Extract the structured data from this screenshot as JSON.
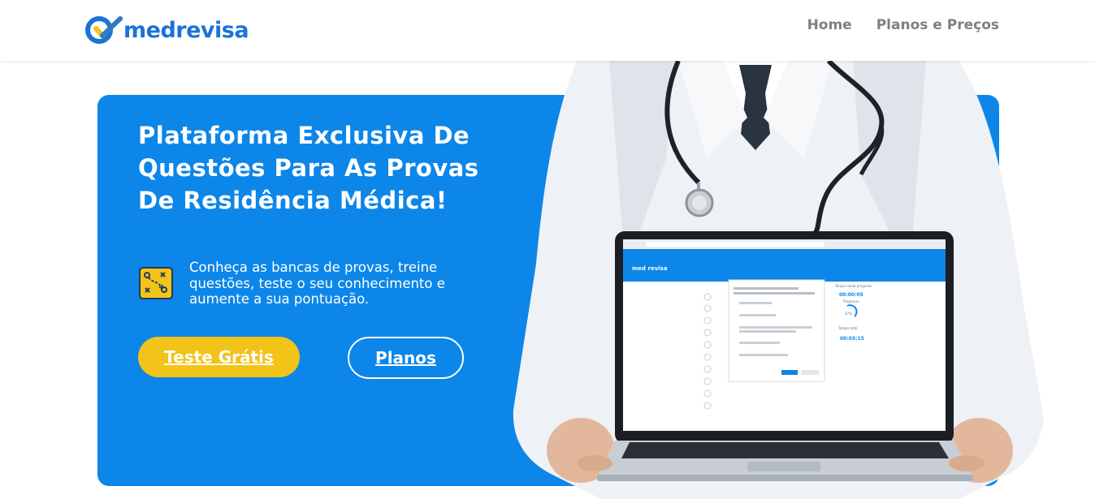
{
  "header": {
    "logo_text": "medrevisa",
    "nav": [
      {
        "label": "Home"
      },
      {
        "label": "Planos e Preços"
      }
    ]
  },
  "hero": {
    "title": "Plataforma Exclusiva De Questões Para As Provas De Residência Médica!",
    "feature_text": "Conheça as bancas de provas, treine questões, teste o seu conhecimento e aumente a sua pontuação.",
    "primary_button": "Teste Grátis",
    "secondary_button": "Planos"
  },
  "laptop_screen": {
    "app_name": "med revisa",
    "timer_label": "Tempo nesta pergunta",
    "timer_value": "00:00:05",
    "progress_label": "Progresso",
    "progress_value": "27%",
    "total_label": "Tempo total",
    "total_value": "00:03:15"
  },
  "colors": {
    "brand_blue": "#0c86e8",
    "logo_blue": "#1b73d6",
    "accent_yellow": "#f2c318",
    "nav_gray": "#7d8085"
  }
}
